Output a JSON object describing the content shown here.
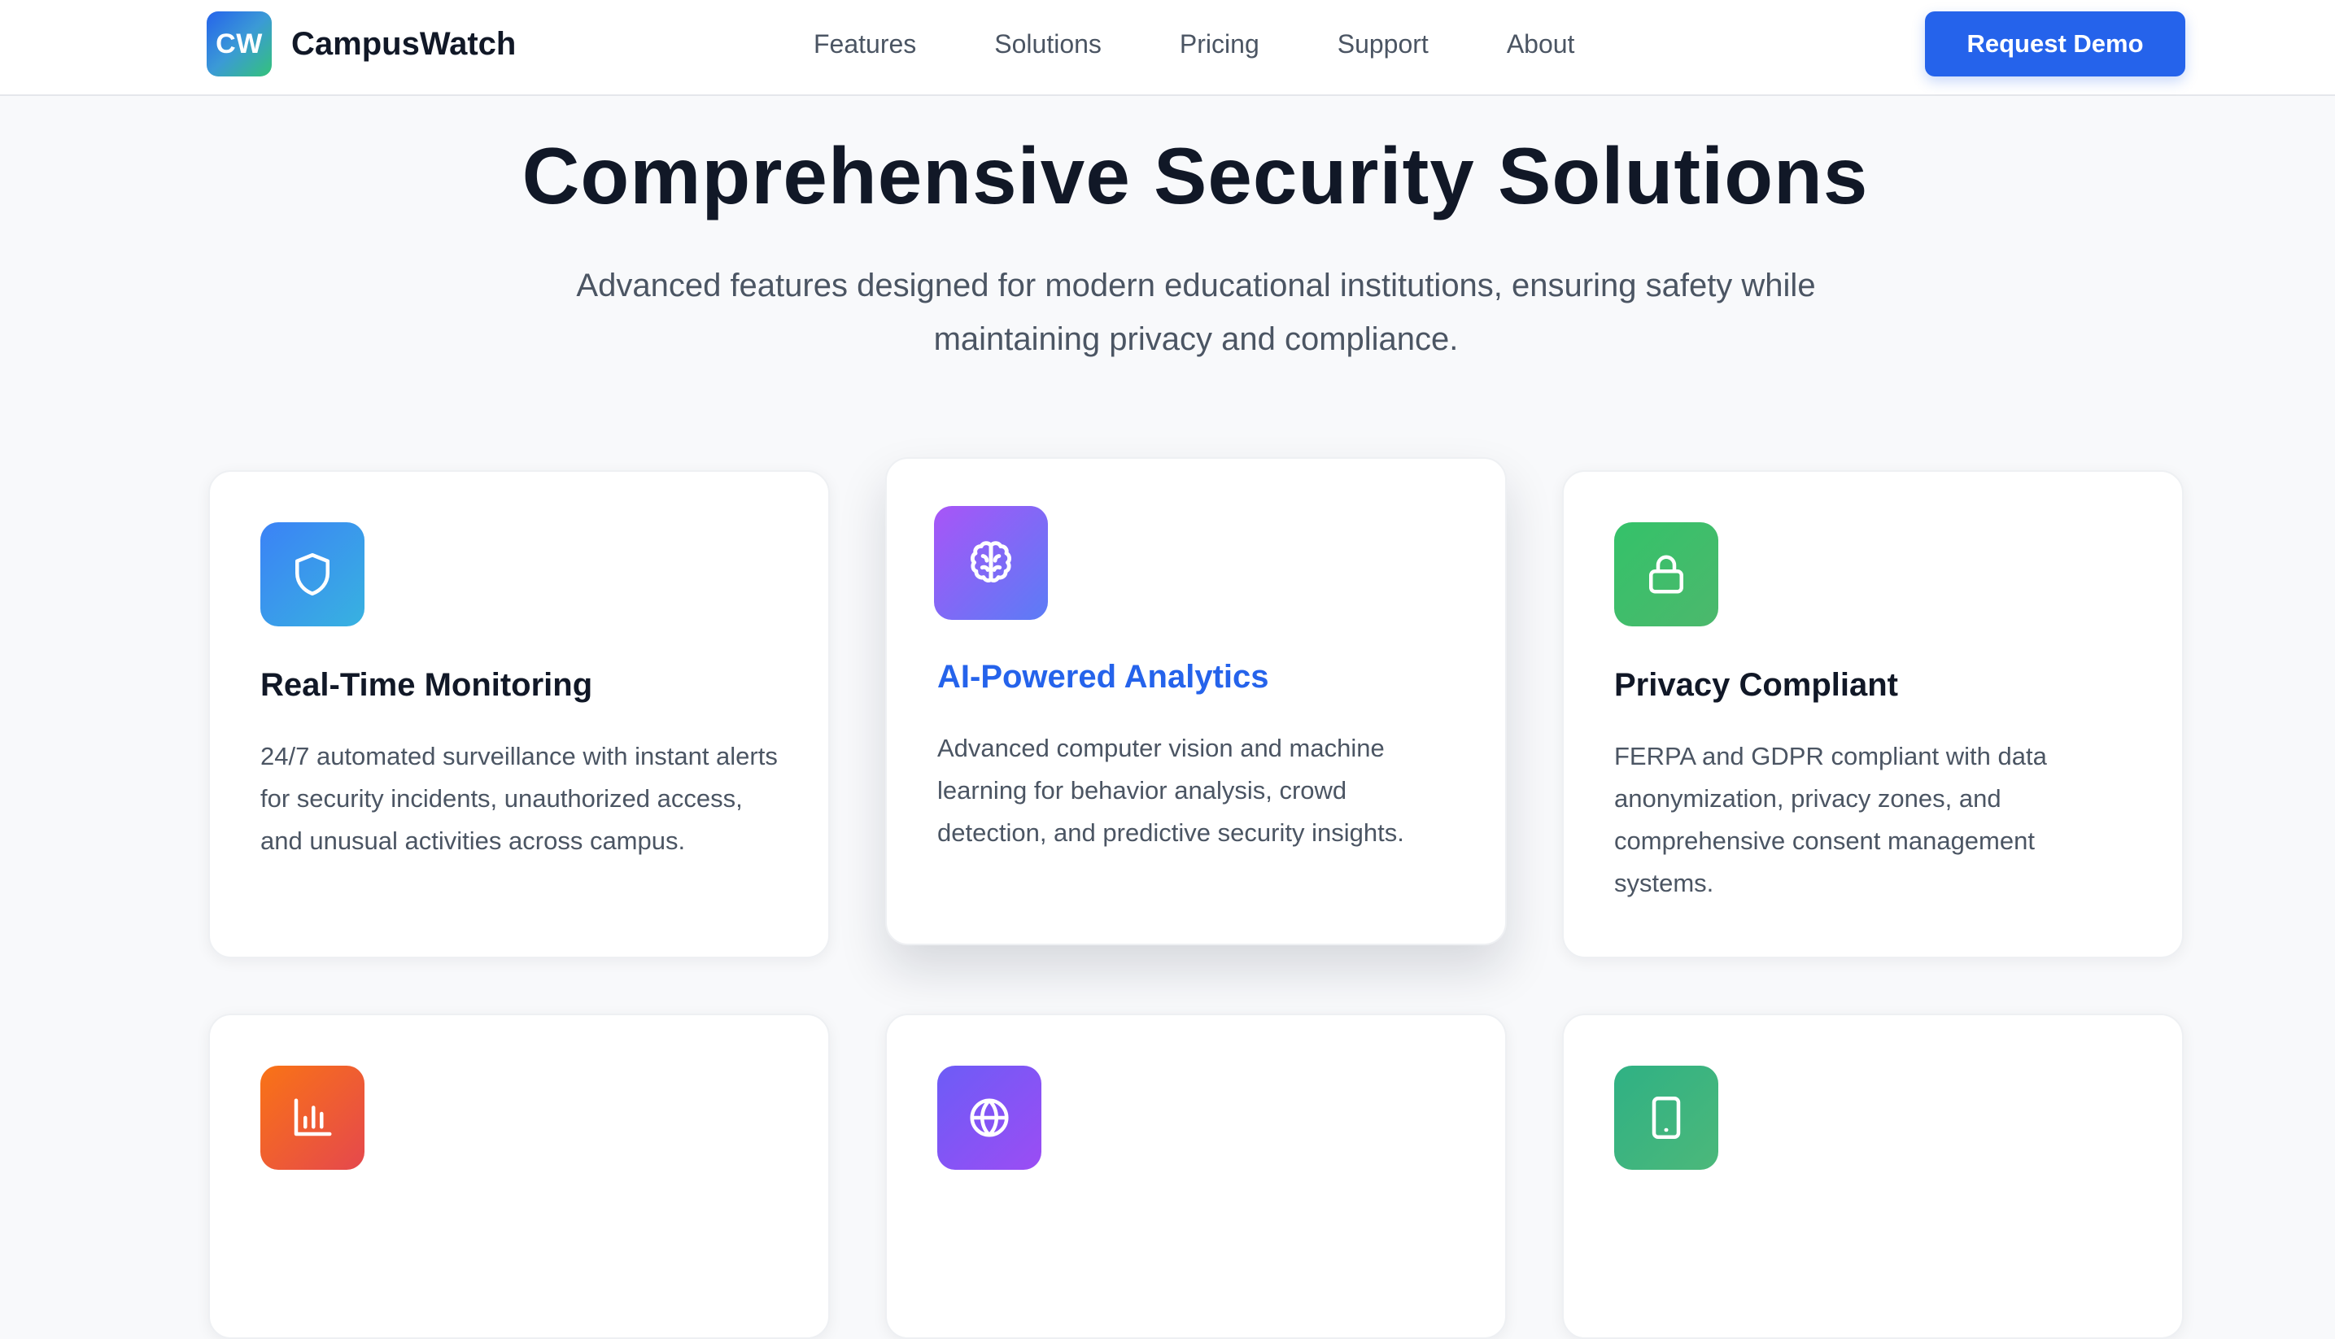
{
  "header": {
    "logo_text": "CW",
    "brand": "CampusWatch",
    "nav": [
      "Features",
      "Solutions",
      "Pricing",
      "Support",
      "About"
    ],
    "cta": "Request Demo"
  },
  "hero": {
    "title": "Comprehensive Security Solutions",
    "subtitle_line1": "Advanced features designed for modern educational institutions, ensuring safety while",
    "subtitle_line2": "maintaining privacy and compliance."
  },
  "cards": [
    {
      "icon": "shield-icon",
      "title": "Real-Time Monitoring",
      "description": "24/7 automated surveillance with instant alerts for security incidents, unauthorized access, and unusual activities across campus."
    },
    {
      "icon": "brain-icon",
      "title": "AI-Powered Analytics",
      "description": "Advanced computer vision and machine learning for behavior analysis, crowd detection, and predictive security insights."
    },
    {
      "icon": "lock-icon",
      "title": "Privacy Compliant",
      "description": "FERPA and GDPR compliant with data anonymization, privacy zones, and comprehensive consent management systems."
    },
    {
      "icon": "bar-chart-icon"
    },
    {
      "icon": "globe-icon"
    },
    {
      "icon": "tablet-icon"
    }
  ],
  "colors": {
    "accent": "#2563eb",
    "heading": "#111827",
    "body_text": "#4b5563",
    "page_bg": "#f8f9fb"
  }
}
